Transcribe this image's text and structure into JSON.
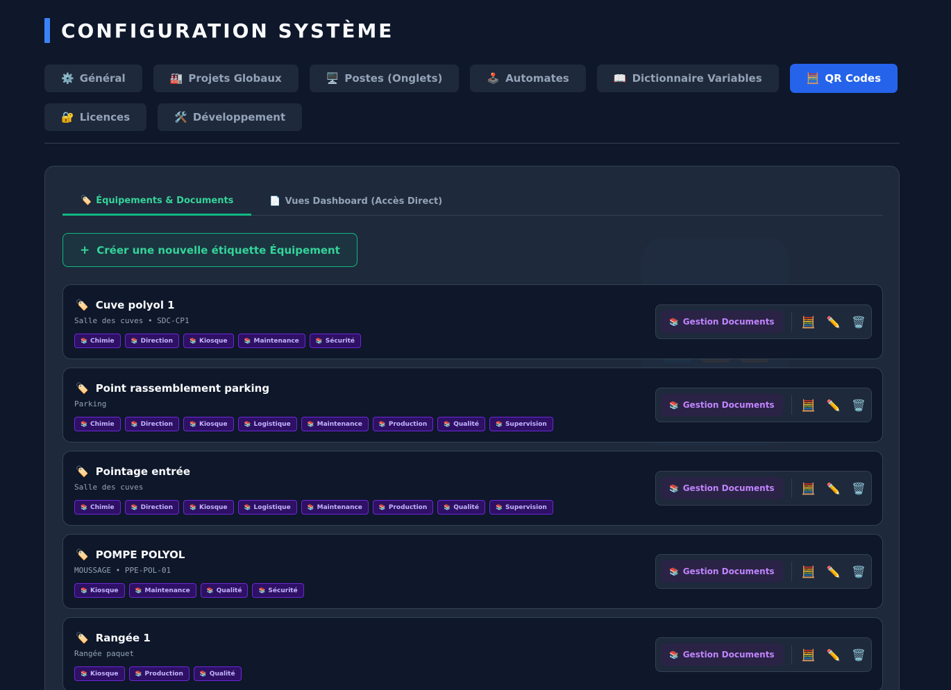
{
  "page_title": "CONFIGURATION SYSTÈME",
  "nav_tabs": [
    {
      "icon": "⚙️",
      "icon_name": "gear-icon",
      "label": "Général",
      "active": false
    },
    {
      "icon": "🏭",
      "icon_name": "factory-icon",
      "label": "Projets Globaux",
      "active": false
    },
    {
      "icon": "🖥️",
      "icon_name": "desktop-icon",
      "label": "Postes (Onglets)",
      "active": false
    },
    {
      "icon": "🕹️",
      "icon_name": "joystick-icon",
      "label": "Automates",
      "active": false
    },
    {
      "icon": "📖",
      "icon_name": "book-icon",
      "label": "Dictionnaire Variables",
      "active": false
    },
    {
      "icon": "🧮",
      "icon_name": "qr-code-icon",
      "label": "QR Codes",
      "active": true
    },
    {
      "icon": "🔐",
      "icon_name": "lock-icon",
      "label": "Licences",
      "active": false
    },
    {
      "icon": "🛠️",
      "icon_name": "tools-icon",
      "label": "Développement",
      "active": false
    }
  ],
  "sub_tabs": [
    {
      "icon": "🏷️",
      "icon_name": "tag-icon",
      "label": "Équipements & Documents",
      "active": true
    },
    {
      "icon": "📄",
      "icon_name": "document-icon",
      "label": "Vues Dashboard (Accès Direct)",
      "active": false
    }
  ],
  "create_button": {
    "icon": "+",
    "label": "Créer une nouvelle étiquette Équipement"
  },
  "actions": {
    "docs_icon": "📚",
    "docs_label": "Gestion Documents",
    "qr_icon": "🧮",
    "edit_icon": "✏️",
    "delete_icon": "🗑️"
  },
  "badge_icon": "📚",
  "equipment_icon": "🏷️",
  "equipment": [
    {
      "name": "Cuve polyol 1",
      "subtitle": "Salle des cuves • SDC-CP1",
      "tags": [
        "Chimie",
        "Direction",
        "Kiosque",
        "Maintenance",
        "Sécurité"
      ]
    },
    {
      "name": "Point rassemblement parking",
      "subtitle": "Parking",
      "tags": [
        "Chimie",
        "Direction",
        "Kiosque",
        "Logistique",
        "Maintenance",
        "Production",
        "Qualité",
        "Supervision"
      ]
    },
    {
      "name": "Pointage entrée",
      "subtitle": "Salle des cuves",
      "tags": [
        "Chimie",
        "Direction",
        "Kiosque",
        "Logistique",
        "Maintenance",
        "Production",
        "Qualité",
        "Supervision"
      ]
    },
    {
      "name": "POMPE POLYOL",
      "subtitle": "MOUSSAGE • PPE-POL-01",
      "tags": [
        "Kiosque",
        "Maintenance",
        "Qualité",
        "Sécurité"
      ]
    },
    {
      "name": "Rangée 1",
      "subtitle": "Rangée paquet",
      "tags": [
        "Kiosque",
        "Production",
        "Qualité"
      ]
    }
  ],
  "colors": {
    "accent": "#2563eb",
    "success": "#10b981",
    "badge_bg": "#2e1065",
    "docs": "#c084fc"
  }
}
